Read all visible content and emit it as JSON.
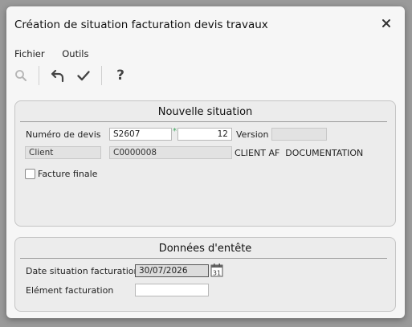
{
  "window": {
    "title": "Création de situation facturation devis travaux"
  },
  "menu": {
    "items": [
      "Fichier",
      "Outils"
    ]
  },
  "toolbar": {
    "icons": [
      "search-icon",
      "undo-icon",
      "checkmark-icon",
      "help-icon"
    ],
    "help_label": "?"
  },
  "panel1": {
    "title": "Nouvelle situation",
    "devis_label": "Numéro de devis",
    "devis_value": "S2607",
    "required_marker": "*",
    "sequence_value": "12",
    "version_label": "Version",
    "version_value": "",
    "client_label": "Client",
    "client_code": "C0000008",
    "client_name": "CLIENT AF  DOCUMENTATION",
    "facture_finale_label": "Facture finale",
    "facture_finale_checked": false
  },
  "panel2": {
    "title": "Données d'entête",
    "date_label": "Date situation facturation",
    "date_value": "30/07/2026",
    "calendar_day": "31",
    "element_label": "Elément facturation",
    "element_value": ""
  },
  "colors": {
    "required": "#3aa45a",
    "icon": "#444444",
    "panel_bg": "#ececec"
  }
}
